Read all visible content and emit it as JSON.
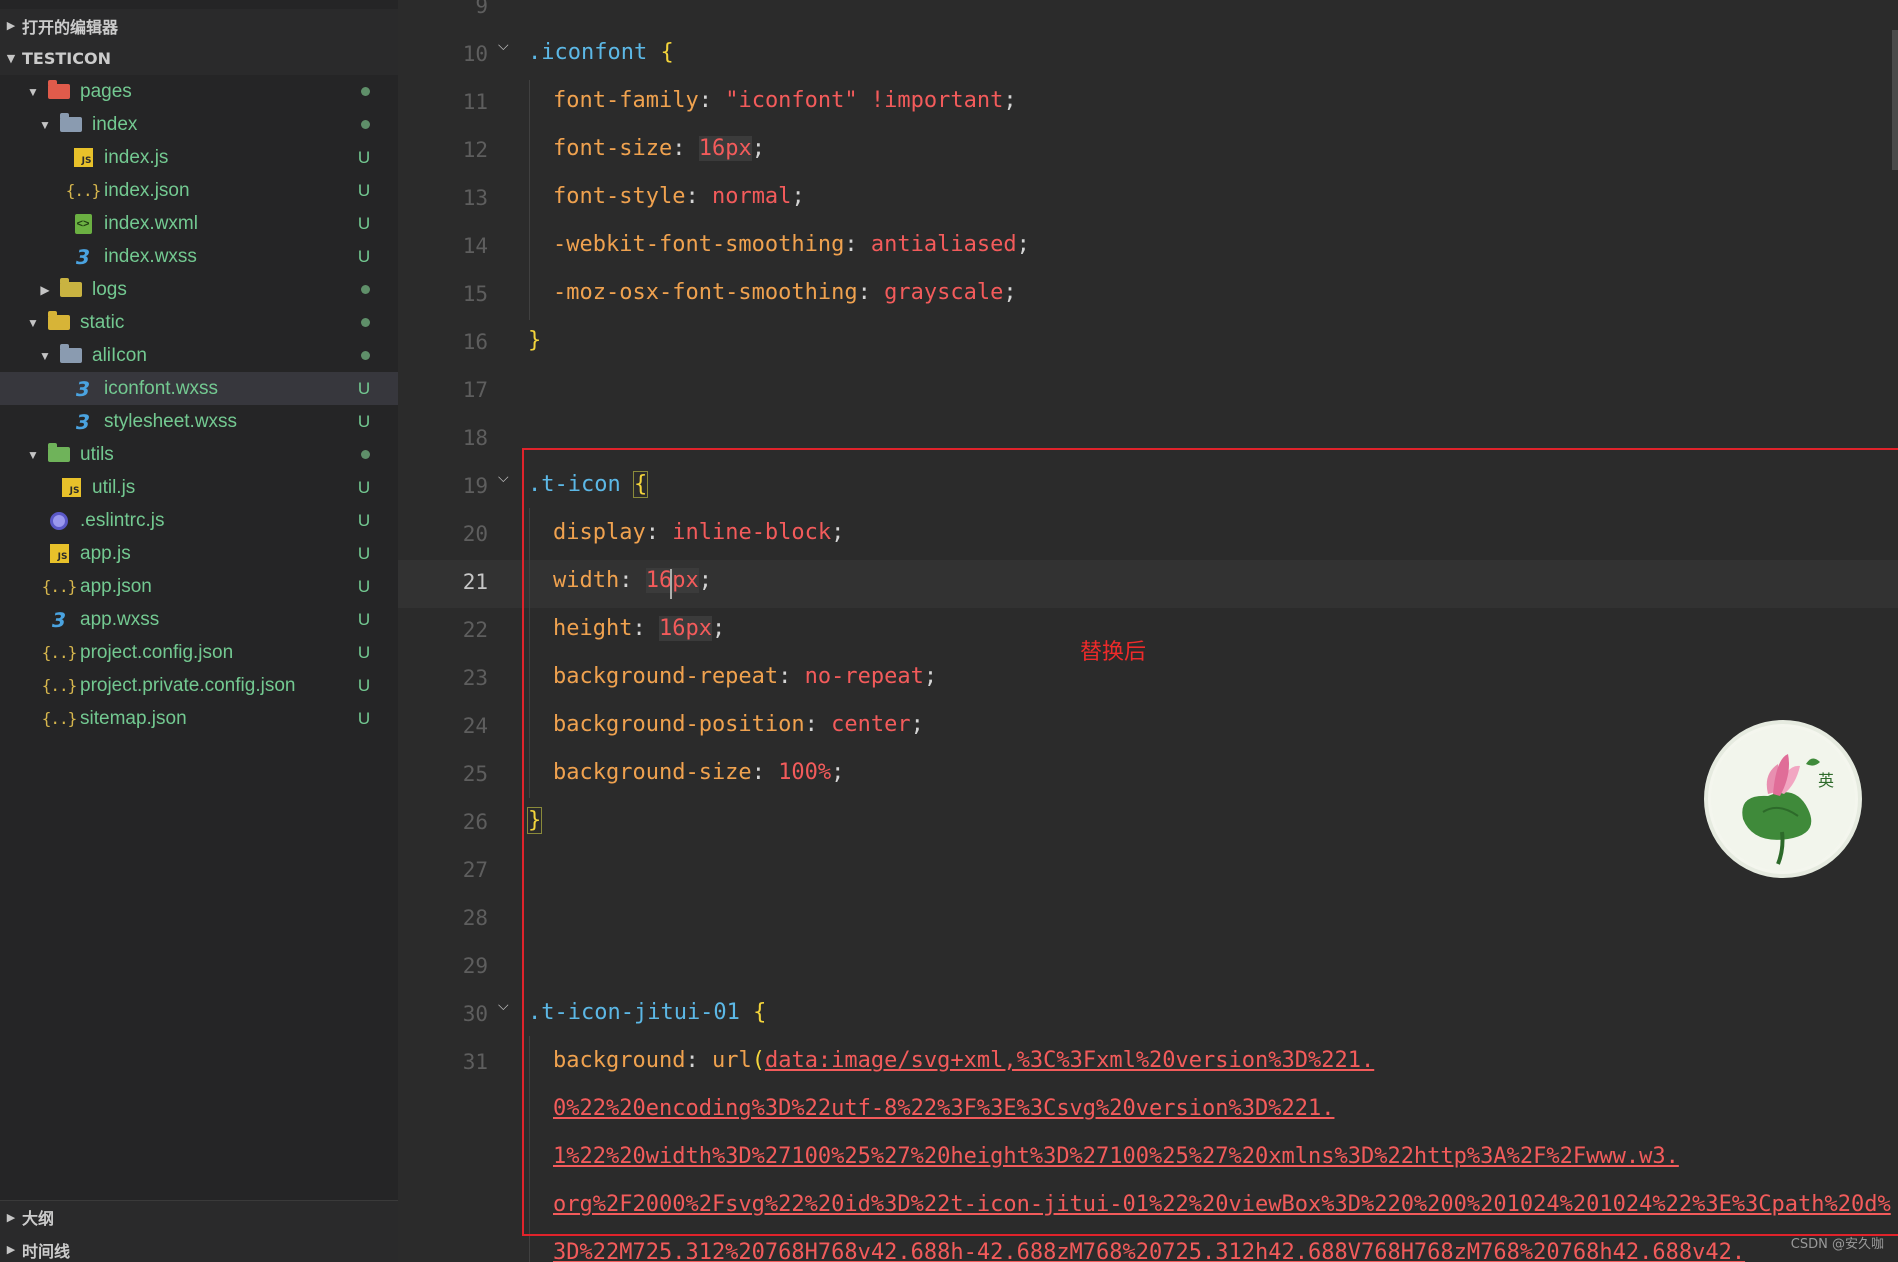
{
  "sidebar": {
    "open_editors_label": "打开的编辑器",
    "project_label": "TESTICON",
    "outline_label": "大纲",
    "timeline_label": "时间线",
    "tree": [
      {
        "name": "pages",
        "kind": "folder",
        "icon": "folder-pages-icon",
        "open": true,
        "status": "dot"
      },
      {
        "name": "index",
        "kind": "folder",
        "icon": "folder-icon",
        "open": true,
        "status": "dot"
      },
      {
        "name": "index.js",
        "kind": "file",
        "icon": "js-file-icon",
        "status": "U"
      },
      {
        "name": "index.json",
        "kind": "file",
        "icon": "json-file-icon",
        "status": "U"
      },
      {
        "name": "index.wxml",
        "kind": "file",
        "icon": "wxml-file-icon",
        "status": "U"
      },
      {
        "name": "index.wxss",
        "kind": "file",
        "icon": "wxss-file-icon",
        "status": "U"
      },
      {
        "name": "logs",
        "kind": "folder",
        "icon": "folder-icon",
        "open": false,
        "status": "dot"
      },
      {
        "name": "static",
        "kind": "folder",
        "icon": "folder-icon",
        "open": true,
        "status": "dot"
      },
      {
        "name": "aliIcon",
        "kind": "folder",
        "icon": "folder-icon",
        "open": true,
        "status": "dot"
      },
      {
        "name": "iconfont.wxss",
        "kind": "file",
        "icon": "wxss-file-icon",
        "status": "U",
        "selected": true
      },
      {
        "name": "stylesheet.wxss",
        "kind": "file",
        "icon": "wxss-file-icon",
        "status": "U"
      },
      {
        "name": "utils",
        "kind": "folder",
        "icon": "folder-icon",
        "open": true,
        "status": "dot"
      },
      {
        "name": "util.js",
        "kind": "file",
        "icon": "js-file-icon",
        "status": "U"
      },
      {
        "name": ".eslintrc.js",
        "kind": "file",
        "icon": "eslint-file-icon",
        "status": "U"
      },
      {
        "name": "app.js",
        "kind": "file",
        "icon": "js-file-icon",
        "status": "U"
      },
      {
        "name": "app.json",
        "kind": "file",
        "icon": "json-file-icon",
        "status": "U"
      },
      {
        "name": "app.wxss",
        "kind": "file",
        "icon": "wxss-file-icon",
        "status": "U"
      },
      {
        "name": "project.config.json",
        "kind": "file",
        "icon": "json-file-icon",
        "status": "U"
      },
      {
        "name": "project.private.config.json",
        "kind": "file",
        "icon": "json-file-icon",
        "status": "U"
      },
      {
        "name": "sitemap.json",
        "kind": "file",
        "icon": "json-file-icon",
        "status": "U"
      }
    ]
  },
  "editor": {
    "active_line": "21",
    "annotation": "替换后",
    "lines": [
      {
        "n": "9"
      },
      {
        "n": "10",
        "fold": true,
        "sel": ".iconfont",
        "open": "{"
      },
      {
        "n": "11",
        "prop": "font-family",
        "val": "\"iconfont\" !important"
      },
      {
        "n": "12",
        "prop": "font-size",
        "num": "16px"
      },
      {
        "n": "13",
        "prop": "font-style",
        "val": "normal"
      },
      {
        "n": "14",
        "prop": "-webkit-font-smoothing",
        "val": "antialiased"
      },
      {
        "n": "15",
        "prop": "-moz-osx-font-smoothing",
        "val": "grayscale"
      },
      {
        "n": "16",
        "close": "}"
      },
      {
        "n": "17"
      },
      {
        "n": "18"
      },
      {
        "n": "19",
        "fold": true,
        "sel": ".t-icon",
        "open": "{"
      },
      {
        "n": "20",
        "prop": "display",
        "val": "inline-block"
      },
      {
        "n": "21",
        "prop": "width",
        "num": "16px",
        "current": true
      },
      {
        "n": "22",
        "prop": "height",
        "num": "16px"
      },
      {
        "n": "23",
        "prop": "background-repeat",
        "val": "no-repeat"
      },
      {
        "n": "24",
        "prop": "background-position",
        "val": "center"
      },
      {
        "n": "25",
        "prop": "background-size",
        "val": "100%"
      },
      {
        "n": "26",
        "close": "}"
      },
      {
        "n": "27"
      },
      {
        "n": "28"
      },
      {
        "n": "29"
      },
      {
        "n": "30",
        "fold": true,
        "sel": ".t-icon-jitui-01",
        "open": "{"
      },
      {
        "n": "31",
        "prop": "background",
        "url_fn": "url(",
        "url": "data:image/svg+xml,%3C%3Fxml%20version%3D%221."
      }
    ],
    "wrapped": [
      "0%22%20encoding%3D%22utf-8%22%3F%3E%3Csvg%20version%3D%221.",
      "1%22%20width%3D%27100%25%27%20height%3D%27100%25%27%20xmlns%3D%22http%3A%2F%2Fwww.w3.",
      "org%2F2000%2Fsvg%22%20id%3D%22t-icon-jitui-01%22%20viewBox%3D%220%200%201024%201024%22%3E%3Cpath%20d%",
      "3D%22M725.312%20768H768v42.688h-42.688zM768%20725.312h42.688V768H768zM768%20768h42.688v42."
    ]
  },
  "badge": {
    "char": "英",
    "icon": "lotus-logo-icon"
  },
  "watermark": "CSDN @安久咖"
}
